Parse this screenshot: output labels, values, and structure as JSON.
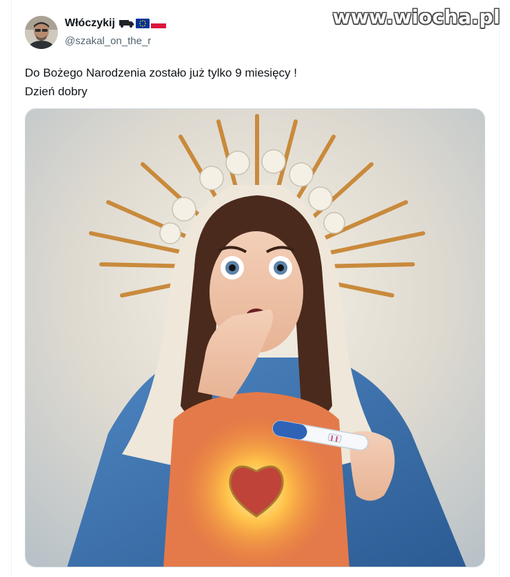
{
  "tweet": {
    "author": {
      "display_name": "Włóczykij",
      "handle": "@szakal_on_the_r",
      "name_emojis": [
        "truck-icon",
        "eu-flag-icon",
        "poland-flag-icon"
      ]
    },
    "text_lines": [
      "Do Bożego Narodzenia zostało już tylko 9 miesięcy !",
      "Dzień dobry"
    ],
    "media": {
      "kind": "illustration"
    }
  },
  "watermark": "www.wiocha.pl",
  "colors": {
    "text_primary": "#0f1419",
    "text_secondary": "#536471",
    "border": "#cfd9de",
    "eu_blue": "#003399",
    "poland_red": "#dc143c"
  }
}
